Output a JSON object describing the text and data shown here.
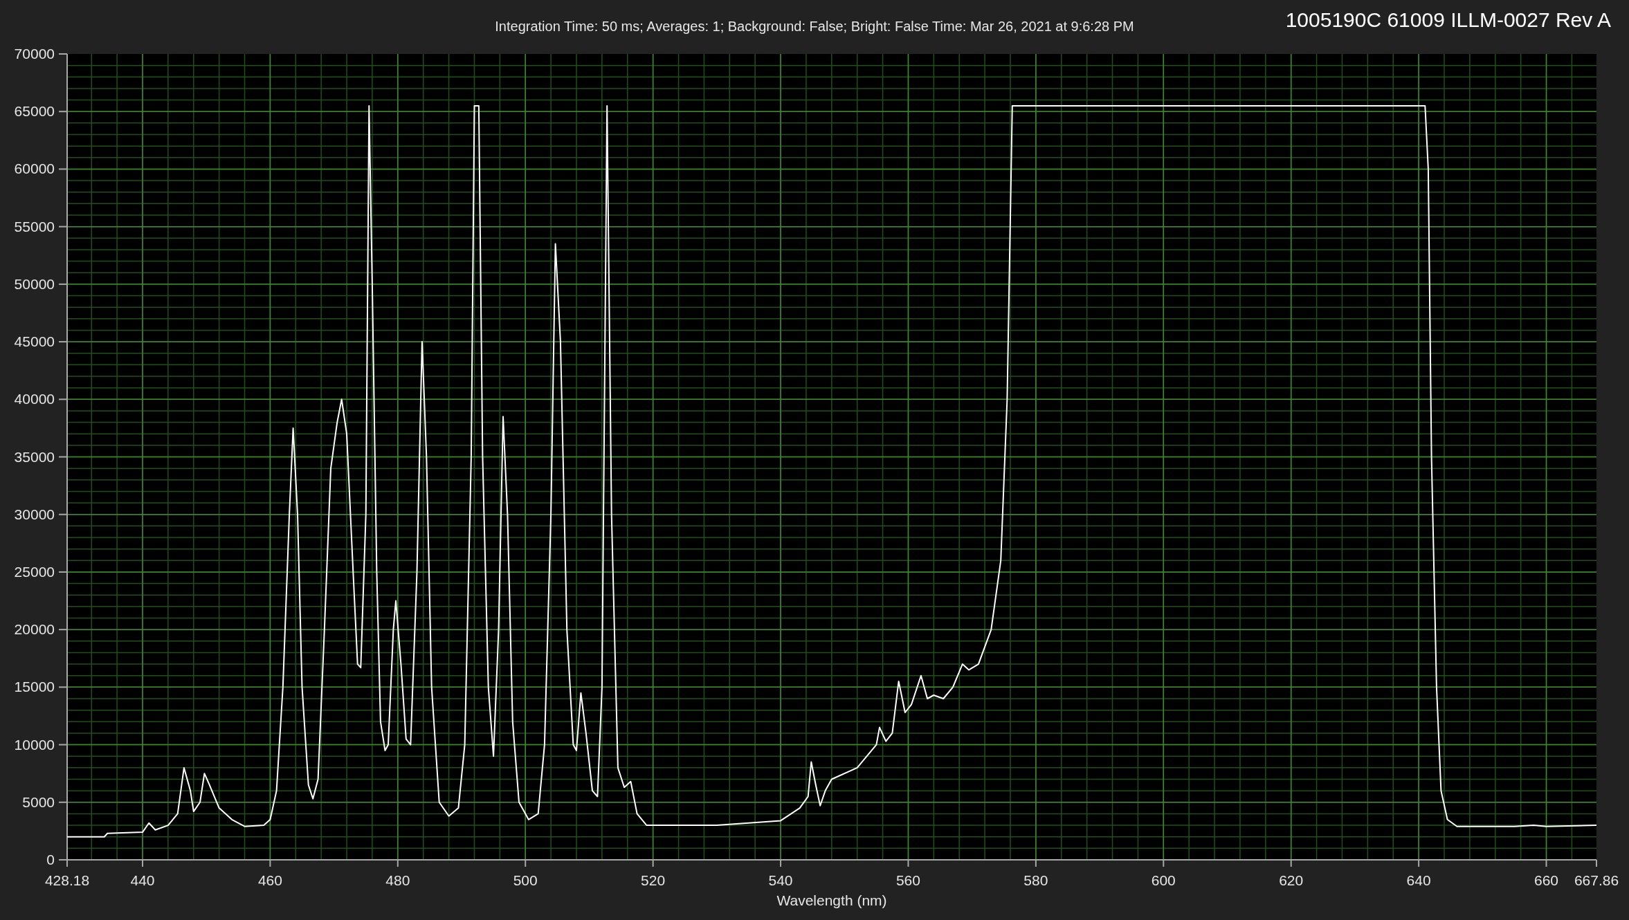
{
  "header": {
    "title": "Integration Time: 50 ms; Averages: 1; Background: False; Bright: False Time: Mar 26, 2021 at 9:6:28 PM",
    "label": "1005190C 61009 ILLM-0027 Rev A"
  },
  "chart_data": {
    "type": "line",
    "xlabel": "Wavelength (nm)",
    "grid": true,
    "xlim": [
      428.18,
      667.86
    ],
    "ylim": [
      0,
      70000
    ],
    "xticks": [
      428.18,
      440,
      460,
      480,
      500,
      520,
      540,
      560,
      580,
      600,
      620,
      640,
      660,
      667.86
    ],
    "yticks": [
      0,
      5000,
      10000,
      15000,
      20000,
      25000,
      30000,
      35000,
      40000,
      45000,
      50000,
      55000,
      60000,
      65000,
      70000
    ],
    "x": [
      428.18,
      434,
      434.5,
      440,
      441,
      442,
      444,
      445.5,
      446.5,
      447.5,
      448,
      449,
      449.7,
      450.5,
      452,
      454,
      456,
      459,
      460,
      461,
      462,
      463,
      463.6,
      464.3,
      465,
      466,
      466.7,
      467.5,
      468.5,
      469.5,
      470.5,
      471.2,
      472,
      473,
      473.7,
      474.2,
      475,
      475.5,
      476,
      476.7,
      477.3,
      478,
      478.5,
      479.3,
      479.7,
      480.5,
      481.3,
      482,
      483,
      483.8,
      484.5,
      485.3,
      486.5,
      488,
      489.5,
      490.5,
      491.5,
      492,
      492.7,
      493.3,
      494.2,
      495,
      495.8,
      496.5,
      497.2,
      498,
      499,
      500.5,
      502,
      503,
      504,
      504.7,
      505.5,
      506.5,
      507.5,
      508,
      508.7,
      509.5,
      510.5,
      511.3,
      512,
      512.8,
      513.5,
      514.5,
      515.5,
      516.5,
      517.5,
      519,
      530,
      540,
      543,
      544.3,
      544.8,
      545.5,
      546.2,
      547,
      548,
      552,
      555,
      555.5,
      556.5,
      557.5,
      558.5,
      559.5,
      560.5,
      562,
      563,
      564,
      565.5,
      567,
      568.5,
      569.5,
      571,
      573,
      574.5,
      575.5,
      576.3,
      641,
      641.5,
      642,
      642.8,
      643.5,
      644.5,
      646,
      655,
      658,
      660,
      667.86
    ],
    "series": [
      {
        "color": "#ffffff",
        "values": [
          2000,
          2000,
          2300,
          2400,
          3200,
          2600,
          3000,
          4000,
          8000,
          6000,
          4200,
          5000,
          7500,
          6500,
          4500,
          3500,
          2900,
          3000,
          3500,
          6000,
          15000,
          30000,
          37500,
          30000,
          15000,
          6500,
          5300,
          7000,
          20000,
          34000,
          38000,
          40000,
          37000,
          25000,
          17000,
          16700,
          30000,
          65500,
          50000,
          25000,
          12000,
          9500,
          10000,
          20000,
          22500,
          17000,
          10500,
          10000,
          25000,
          45000,
          35000,
          15000,
          5000,
          3800,
          4500,
          10000,
          35000,
          65500,
          65500,
          35000,
          15000,
          9000,
          20000,
          38500,
          30000,
          12000,
          5000,
          3500,
          4000,
          10000,
          30000,
          53500,
          45000,
          20000,
          10000,
          9500,
          14500,
          11000,
          6000,
          5500,
          15000,
          65500,
          30000,
          8000,
          6300,
          6800,
          4000,
          3000,
          3000,
          3400,
          4500,
          5500,
          8500,
          6500,
          4700,
          6000,
          7000,
          8000,
          10000,
          11500,
          10300,
          11000,
          15500,
          12800,
          13500,
          16000,
          14000,
          14300,
          14000,
          15000,
          17000,
          16500,
          17000,
          20000,
          26000,
          40000,
          65500,
          65500,
          60000,
          35000,
          15000,
          6000,
          3500,
          2900,
          2900,
          3000,
          2900,
          3000
        ]
      }
    ]
  }
}
